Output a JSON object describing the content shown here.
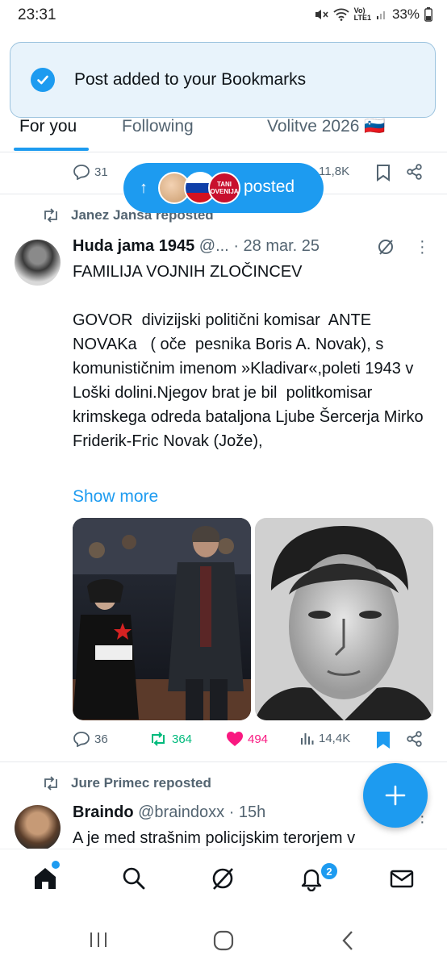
{
  "status_bar": {
    "time": "23:31",
    "network_label_top": "Vo)",
    "network_label_bottom": "LTE1",
    "battery": "33%"
  },
  "toast": {
    "message": "Post added to your Bookmarks"
  },
  "tabs": [
    {
      "label": "For you",
      "active": true
    },
    {
      "label": "Following",
      "active": false
    },
    {
      "label": "Volitve 2026 🇸🇮",
      "active": false
    }
  ],
  "new_posts_pill": {
    "label": "posted",
    "avatar_text": "TANI\nOVENIJA"
  },
  "prev_post_actions": {
    "replies": "31",
    "views": "11,8K"
  },
  "post1": {
    "reposted_by": "Janez Janša reposted",
    "author_name": "Huda jama 1945",
    "handle": "@...",
    "time": "· 28 mar. 25",
    "text": "FAMILIJA VOJNIH ZLOČINCEV\n\nGOVOR  divizijski politični komisar  ANTE NOVAKa   ( oče  pesnika Boris A. Novak), s komunističnim imenom »Kladivar«,poleti 1943 v Loški dolini.Njegov brat je bil  politkomisar krimskega odreda bataljona Ljube Šercerja Mirko Friderik-Fric Novak (Jože),",
    "show_more": "Show more",
    "replies": "36",
    "reposts": "364",
    "likes": "494",
    "views": "14,4K"
  },
  "post2": {
    "reposted_by": "Jure Primec reposted",
    "author_name": "Braindo",
    "handle": "@braindoxx",
    "time": "· 15h",
    "text": "A je med strašnim policijskim terorjem v"
  },
  "bottom_nav": {
    "notifications_badge": "2"
  },
  "colors": {
    "accent": "#1d9bf0",
    "repost_green": "#00ba7c",
    "like_pink": "#f91880",
    "secondary_text": "#536471"
  }
}
